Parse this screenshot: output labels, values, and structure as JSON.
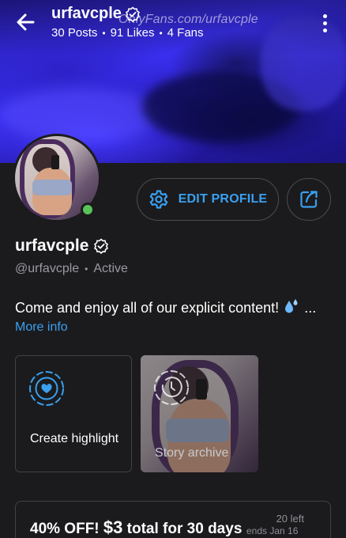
{
  "header": {
    "name": "urfavcple",
    "stats": {
      "posts": "30 Posts",
      "likes": "91 Likes",
      "fans": "4 Fans"
    },
    "separator": "•",
    "watermark": "OnlyFans.com/urfavcple"
  },
  "actions": {
    "edit_profile_label": "EDIT PROFILE"
  },
  "profile": {
    "display_name": "urfavcple",
    "handle": "@urfavcple",
    "status": "Active",
    "online": true,
    "bio": "Come and enjoy all of our explicit content!",
    "bio_ellipsis": "...",
    "more_info_label": "More info"
  },
  "highlights": {
    "create_label": "Create highlight",
    "archive_label": "Story archive"
  },
  "promo": {
    "text": "40% OFF!",
    "price": "$3",
    "suffix": "total for 30 days",
    "remaining": "20 left",
    "ends": "ends Jan 16"
  },
  "colors": {
    "accent": "#3aa0f0",
    "online": "#59c35a",
    "background": "#1b1b1d"
  }
}
